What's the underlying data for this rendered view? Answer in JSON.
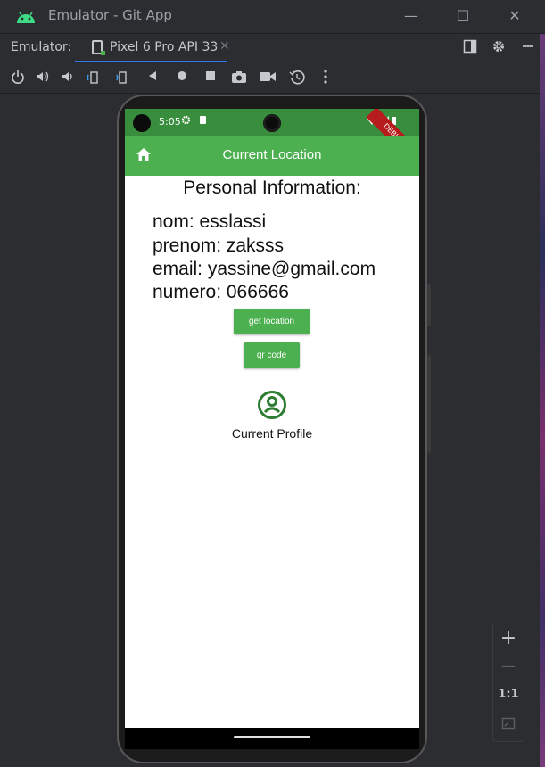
{
  "window": {
    "title": "Emulator - Git App",
    "minimize": "—",
    "maximize": "☐",
    "close": "✕"
  },
  "tabbar": {
    "label": "Emulator:",
    "tab_name": "Pixel 6 Pro API 33",
    "tab_close": "✕"
  },
  "phone": {
    "status": {
      "time": "5:05",
      "debug_banner": "DEBUG"
    },
    "appbar": {
      "title": "Current Location"
    },
    "content": {
      "heading": "Personal Information:",
      "nom": "nom: esslassi",
      "prenom": "prenom: zaksss",
      "email": "email: yassine@gmail.com",
      "numero": "numero: 066666",
      "get_location_label": "get location",
      "qr_code_label": "qr code",
      "profile_label": "Current Profile"
    }
  },
  "zoom": {
    "in": "+",
    "out": "—",
    "actual": "1:1"
  },
  "colors": {
    "app_green": "#4caf50",
    "status_green": "#388e3c",
    "ide_background": "#2b2d30",
    "accent_blue": "#3574f0"
  }
}
